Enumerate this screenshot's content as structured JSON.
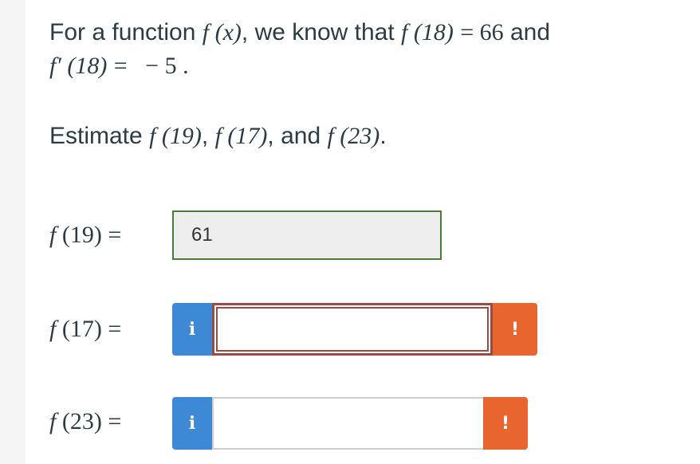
{
  "problem": {
    "intro": "For a function",
    "fx": "f (x)",
    "known": ", we know that",
    "f18": "f (18)",
    "eq_66": "= 66",
    "and": "and",
    "fprime18": "f′ (18)",
    "eq_neg5": "=   − 5 ."
  },
  "estimate": {
    "prefix": "Estimate",
    "f19": "f (19)",
    "sep1": ",",
    "f17": "f (17)",
    "sep2": ", and",
    "f23": "f (23)",
    "suffix": "."
  },
  "answers": [
    {
      "label_fn": "f",
      "label_arg": " (19)",
      "eq": " =",
      "value": "61"
    },
    {
      "label_fn": "f",
      "label_arg": " (17)",
      "eq": " =",
      "value": "",
      "info": "i",
      "warn": "!"
    },
    {
      "label_fn": "f",
      "label_arg": " (23)",
      "eq": " =",
      "value": "",
      "info": "i",
      "warn": "!"
    }
  ]
}
